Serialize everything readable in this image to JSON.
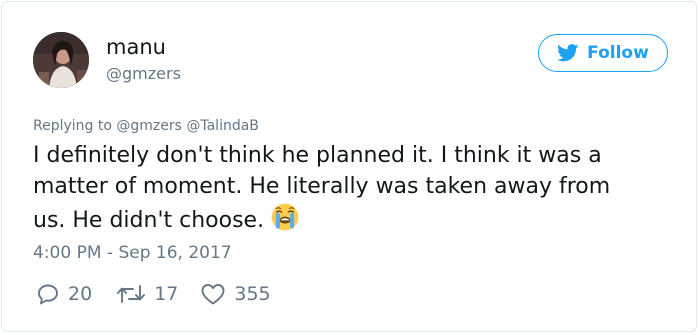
{
  "user": {
    "display_name": "manu",
    "handle": "@gmzers"
  },
  "follow_label": "Follow",
  "replying_to": "Replying to @gmzers @TalindaB",
  "tweet": {
    "text": "I definitely don't think he planned it. I think it was a\nmatter of moment. He literally was taken away from\nus. He didn't choose.",
    "emoji": "loudly-crying-face"
  },
  "timestamp": "4:00 PM - Sep 16, 2017",
  "stats": {
    "replies": "20",
    "retweets": "17",
    "likes": "355"
  },
  "colors": {
    "accent": "#1da1f2",
    "muted": "#657786",
    "text": "#14171a",
    "border": "#e1e8ed"
  }
}
